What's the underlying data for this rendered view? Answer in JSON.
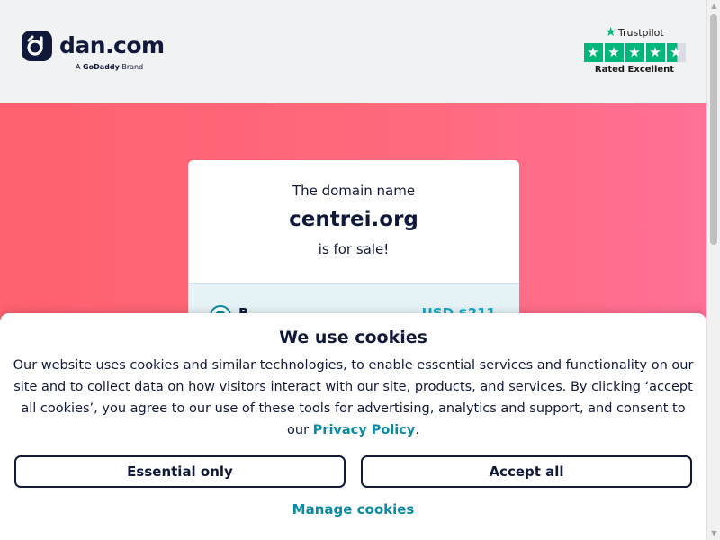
{
  "header": {
    "logo_icon": "dan-logo-icon",
    "brand_name": "dan.com",
    "brand_sub_prefix": "A",
    "brand_sub_company": "GoDaddy",
    "brand_sub_suffix": "Brand",
    "trustpilot": {
      "name": "Trustpilot",
      "rating_text": "Rated Excellent",
      "stars": 4.5,
      "color": "#00b67a"
    }
  },
  "hero": {
    "gradient_start": "#fe616f",
    "gradient_end": "#ff7096"
  },
  "card": {
    "line1": "The domain name",
    "domain": "centrei.org",
    "line3": "is for sale!",
    "option_label": "B",
    "option_price": "USD $211"
  },
  "cookie": {
    "title": "We use cookies",
    "body": "Our website uses cookies and similar technologies, to enable essential services and functionality on our site and to collect data on how visitors interact with our site, products, and services. By clicking ‘accept all cookies’, you agree to our use of these tools for advertising, analytics and support, and consent to our",
    "privacy_link": "Privacy Policy",
    "period": ".",
    "essential_button": "Essential only",
    "accept_button": "Accept all",
    "manage_link": "Manage cookies",
    "accent_color": "#0b8aa3"
  },
  "scrollbar": {
    "up_glyph": "▲",
    "down_glyph": "▼"
  }
}
